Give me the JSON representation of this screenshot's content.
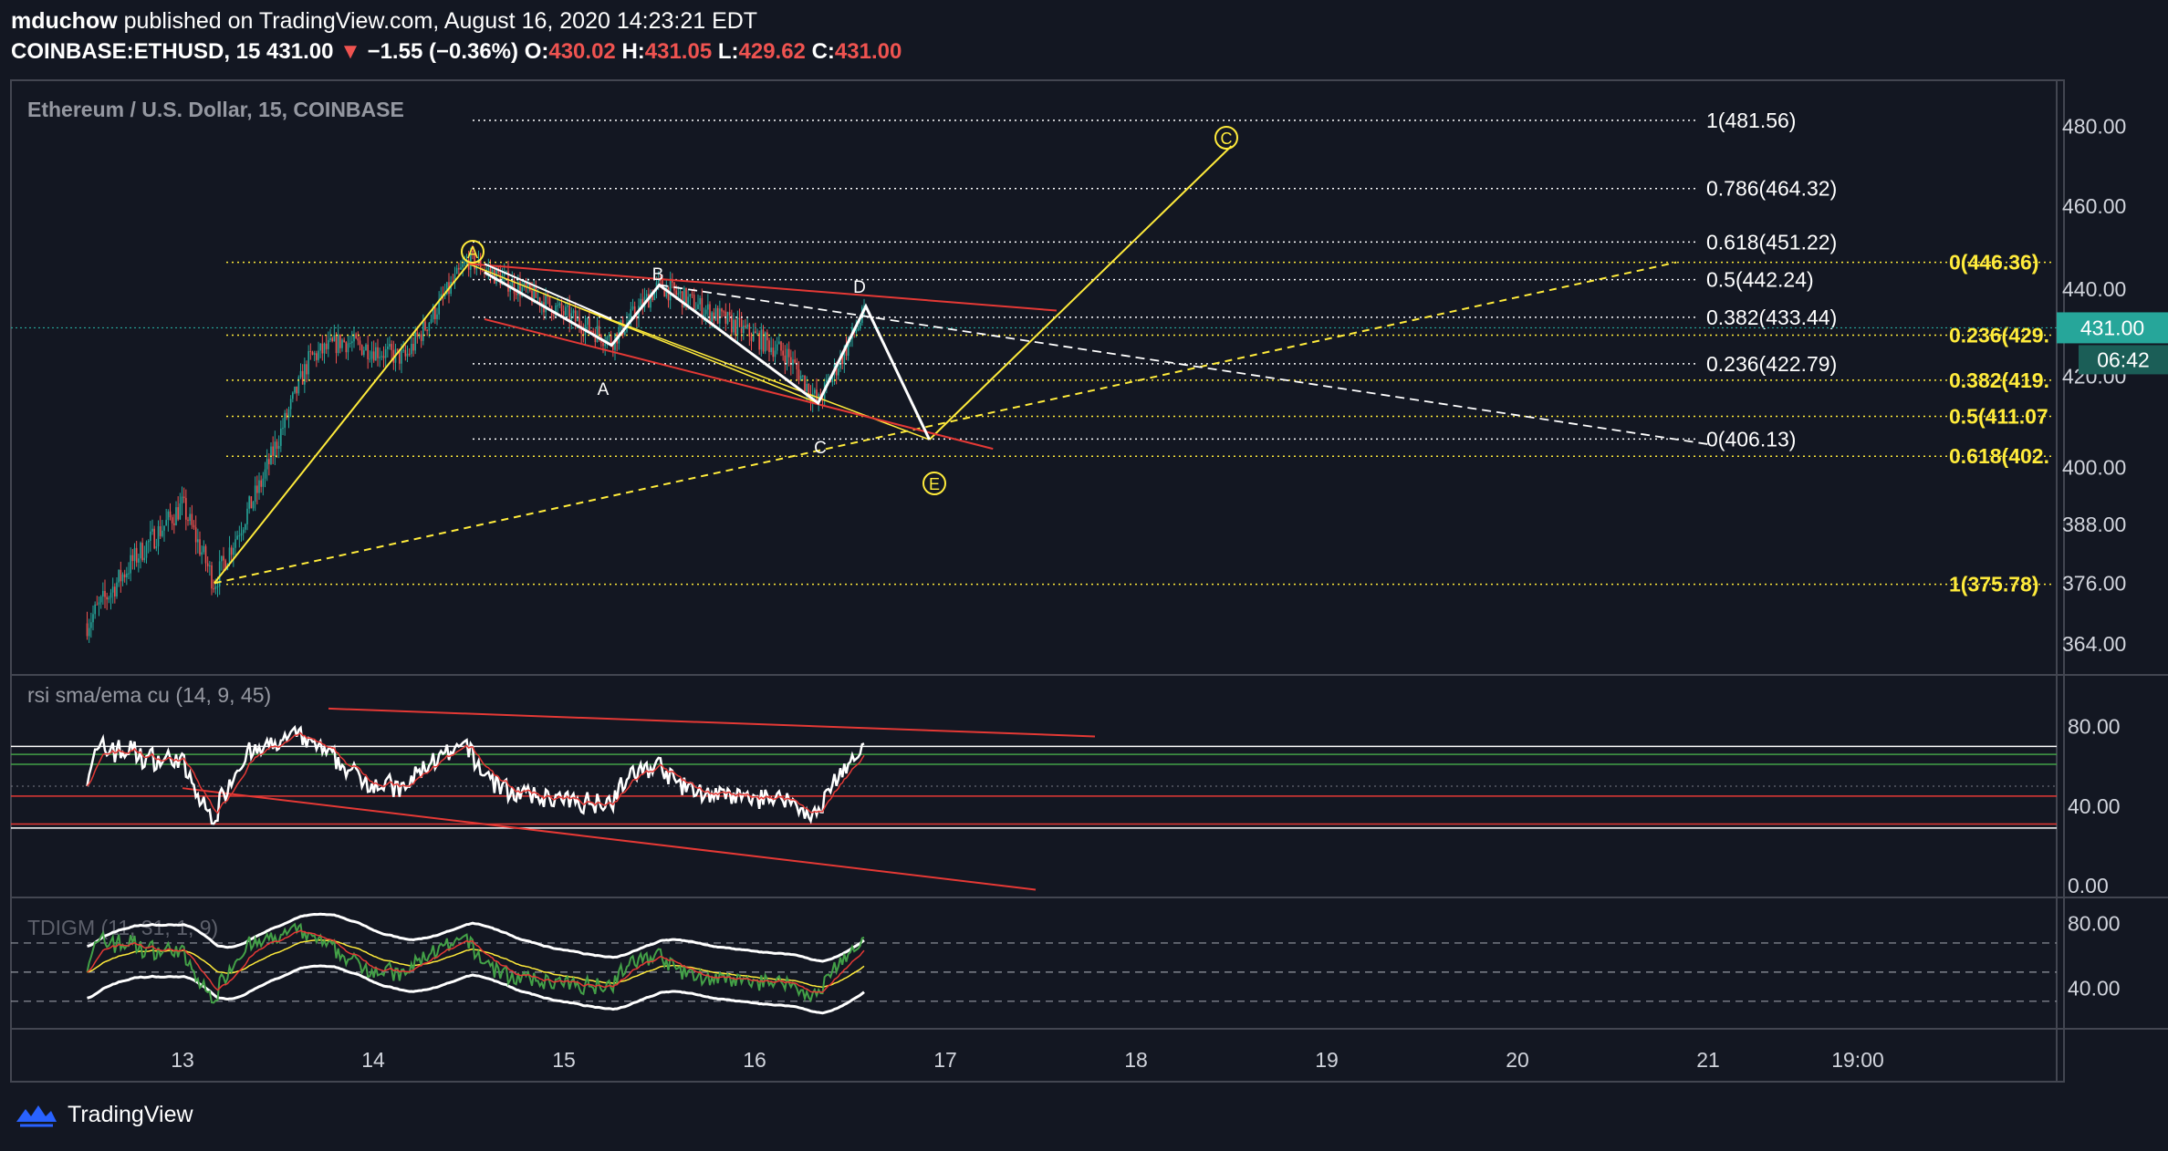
{
  "header": {
    "author": "mduchow",
    "published_text": "published on TradingView.com, August 16, 2020 14:23:21 EDT",
    "symbol": "COINBASE:ETHUSD, 15",
    "price": "431.00",
    "change_arrow": "▼",
    "change": "−1.55 (−0.36%)",
    "o_label": "O:",
    "o_value": "430.02",
    "h_label": "H:",
    "h_value": "431.05",
    "l_label": "L:",
    "l_value": "429.62",
    "c_label": "C:",
    "c_value": "431.00"
  },
  "brand": {
    "name": "TradingView"
  },
  "colors": {
    "background": "#131722",
    "up": "#26a69a",
    "down": "#ef5350",
    "fib_yellow": "#ffeb3b",
    "text": "#d1d4dc",
    "red_line": "#e53935",
    "rsi_line": "#ffffff",
    "tdi_green": "#43a047"
  },
  "chart_data": [
    {
      "type": "candlestick",
      "title": "Ethereum / U.S. Dollar, 15, COINBASE",
      "x_ticks": [
        "13",
        "14",
        "15",
        "16",
        "17",
        "18",
        "19",
        "20",
        "21",
        "19:00"
      ],
      "y_ticks": [
        "480.00",
        "460.00",
        "440.00",
        "420.00",
        "400.00",
        "388.00",
        "376.00",
        "364.00"
      ],
      "y_scale": "log",
      "ylim": [
        358,
        492
      ],
      "last_price_label": "431.00",
      "countdown_label": "06:42",
      "price_path_key_points": [
        {
          "x": "12 Aug 12:00",
          "y": 368
        },
        {
          "x": "12 Aug 18:00",
          "y": 381
        },
        {
          "x": "13 Aug 00:00",
          "y": 392
        },
        {
          "x": "13 Aug 04:00",
          "y": 376
        },
        {
          "x": "13 Aug 10:00",
          "y": 397
        },
        {
          "x": "13 Aug 16:00",
          "y": 424
        },
        {
          "x": "13 Aug 20:00",
          "y": 428
        },
        {
          "x": "14 Aug 04:00",
          "y": 424
        },
        {
          "x": "14 Aug 12:00",
          "y": 447
        },
        {
          "x": "15 Aug 06:00",
          "y": 428
        },
        {
          "x": "15 Aug 12:00",
          "y": 441
        },
        {
          "x": "16 Aug 04:00",
          "y": 425
        },
        {
          "x": "16 Aug 08:00",
          "y": 414
        },
        {
          "x": "16 Aug 14:00",
          "y": 435
        }
      ],
      "fib_labels_white": [
        "1(481.56)",
        "0.786(464.32)",
        "0.618(451.22)",
        "0.5(442.24)",
        "0.382(433.44)",
        "0.236(422.79)",
        "0(406.13)"
      ],
      "fib_labels_yellow": [
        "0(446.36)",
        "0.236(429.",
        "0.382(419.",
        "0.5(411.07",
        "0.618(402.",
        "1(375.78)"
      ],
      "wave_labels_circled": [
        "A",
        "C",
        "E"
      ],
      "wave_labels_plain": [
        "A",
        "B",
        "C",
        "D"
      ]
    },
    {
      "type": "line",
      "title": "rsi sma/ema cu (14, 9, 45)",
      "y_ticks": [
        "80.00",
        "40.00",
        "0.00"
      ],
      "ylim": [
        -5,
        105
      ],
      "levels": [
        70,
        66,
        61,
        45,
        31,
        29
      ]
    },
    {
      "type": "line",
      "title": "TDIGM (11, 31, 1, 9)",
      "y_ticks": [
        "80.00",
        "40.00"
      ],
      "ylim": [
        15,
        95
      ],
      "levels": [
        68,
        50,
        32
      ]
    }
  ]
}
